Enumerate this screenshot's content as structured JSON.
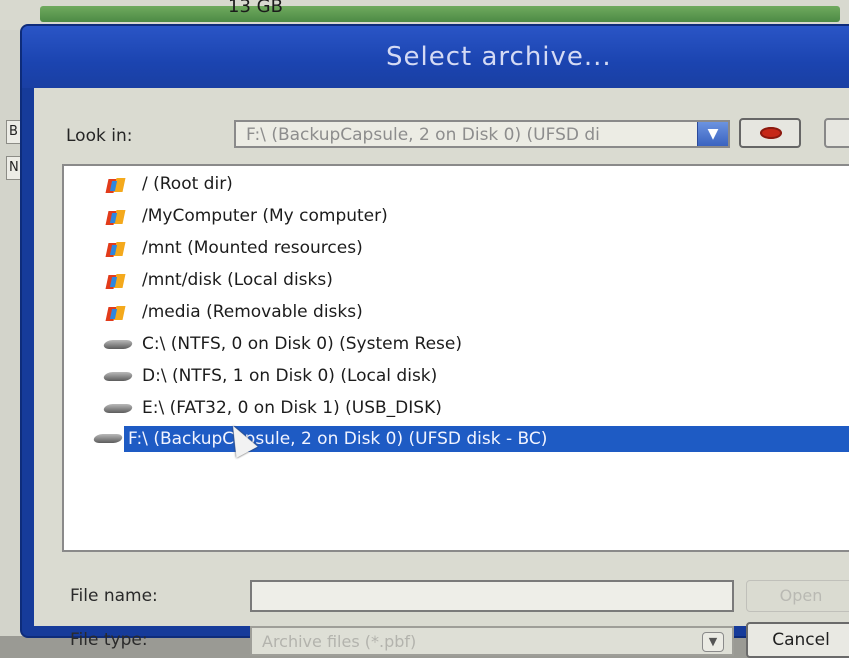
{
  "background": {
    "size_text": "13 GB"
  },
  "dialog": {
    "title": "Select archive...",
    "look_in_label": "Look in:",
    "look_in_value": "F:\\  (BackupCapsule, 2 on Disk 0) (UFSD di",
    "items": [
      {
        "label": "/ (Root dir)",
        "icon": "system-icon"
      },
      {
        "label": "/MyComputer (My computer)",
        "icon": "system-icon"
      },
      {
        "label": "/mnt (Mounted resources)",
        "icon": "system-icon"
      },
      {
        "label": "/mnt/disk (Local disks)",
        "icon": "system-icon"
      },
      {
        "label": "/media (Removable disks)",
        "icon": "system-icon"
      },
      {
        "label": "C:\\  (NTFS, 0 on Disk 0) (System Rese)",
        "icon": "disk-icon"
      },
      {
        "label": "D:\\  (NTFS, 1 on Disk 0) (Local disk)",
        "icon": "disk-icon"
      },
      {
        "label": "E:\\  (FAT32, 0 on Disk 1) (USB_DISK)",
        "icon": "disk-icon"
      },
      {
        "label": "F:\\  (BackupCapsule, 2 on Disk 0) (UFSD disk - BC)",
        "icon": "disk-icon",
        "selected": true
      }
    ],
    "file_name_label": "File name:",
    "file_name_value": "",
    "file_type_label": "File type:",
    "file_type_value": "Archive files (*.pbf)",
    "open_label": "Open",
    "cancel_label": "Cancel"
  },
  "colors": {
    "title_bar": "#1b44b0",
    "selection": "#1e5bc4"
  }
}
